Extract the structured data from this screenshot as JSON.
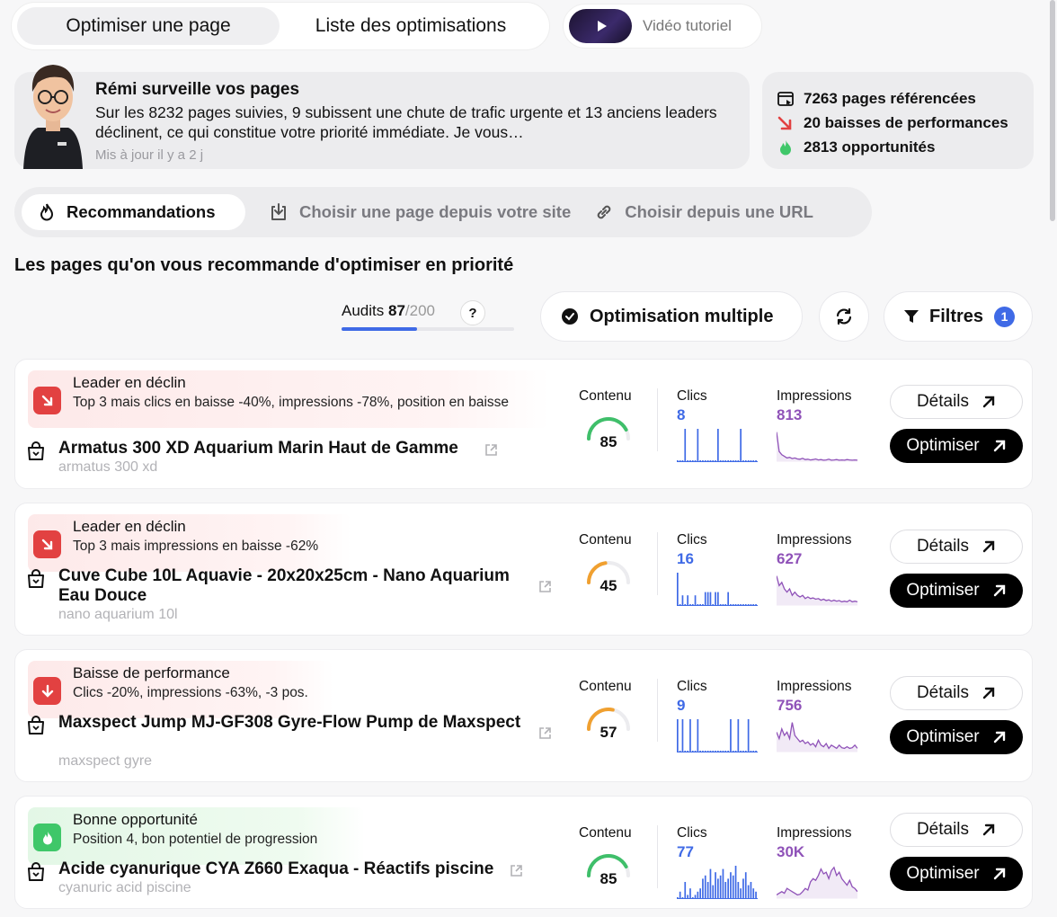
{
  "top_tabs": {
    "optimize": "Optimiser une page",
    "list": "Liste des optimisations",
    "video": "Vidéo tutoriel"
  },
  "remi": {
    "title": "Rémi surveille vos pages",
    "text": "Sur les 8232 pages suivies, 9 subissent une chute de trafic urgente et 13 anciens leaders déclinent, ce qui constitue votre priorité immédiate. Je vous…",
    "updated": "Mis à jour il y a 2 j"
  },
  "stats": {
    "indexed": "7263 pages référencées",
    "declines": "20 baisses de performances",
    "opportunities": "2813 opportunités"
  },
  "source_tabs": {
    "recommendations": "Recommandations",
    "from_site": "Choisir une page depuis votre site",
    "from_url": "Choisir depuis une URL"
  },
  "section_title": "Les pages qu'on vous recommande d'optimiser en priorité",
  "toolbar": {
    "audits_label": "Audits",
    "audits_used": "87",
    "audits_total": "/200",
    "audits_progress": 0.435,
    "help": "?",
    "multi_label": "Optimisation multiple",
    "filters_label": "Filtres",
    "filters_count": "1"
  },
  "labels": {
    "content": "Contenu",
    "clicks": "Clics",
    "impressions": "Impressions",
    "details": "Détails",
    "optimize": "Optimiser"
  },
  "colors": {
    "blue": "#3f6ae6",
    "purple": "#8f52b8",
    "green_gauge": "#3fbf6a",
    "orange_gauge": "#f0a030",
    "red_tag": "#e24141",
    "green_tag": "#3fc769"
  },
  "cards": [
    {
      "tag_color": "red",
      "tag_icon": "arrow-down-right-icon",
      "tag_title": "Leader en déclin",
      "tag_desc": "Top 3 mais clics en baisse -40%, impressions -78%, position en baisse",
      "title": "Armatus 300 XD Aquarium Marin Haut de Gamme",
      "keyword": "armatus 300 xd",
      "content_score": "85",
      "clicks": "8",
      "impressions": "813"
    },
    {
      "tag_color": "red",
      "tag_icon": "arrow-down-right-icon",
      "tag_title": "Leader en déclin",
      "tag_desc": "Top 3 mais impressions en baisse -62%",
      "title": "Cuve Cube 10L Aquavie - 20x20x25cm - Nano Aquarium Eau Douce",
      "keyword": "nano aquarium 10l",
      "content_score": "45",
      "clicks": "16",
      "impressions": "627"
    },
    {
      "tag_color": "red",
      "tag_icon": "arrow-down-icon",
      "tag_title": "Baisse de performance",
      "tag_desc": "Clics -20%, impressions -63%, -3 pos.",
      "title": "Maxspect Jump MJ-GF308 Gyre-Flow Pump de Maxspect",
      "keyword": "maxspect gyre",
      "content_score": "57",
      "clicks": "9",
      "impressions": "756"
    },
    {
      "tag_color": "green",
      "tag_icon": "flame-icon",
      "tag_title": "Bonne opportunité",
      "tag_desc": "Position 4, bon potentiel de progression",
      "title": "Acide cyanurique CYA Z660 Exaqua - Réactifs piscine",
      "keyword": "cyanuric acid piscine",
      "content_score": "85",
      "clicks": "77",
      "impressions": "30K"
    }
  ]
}
